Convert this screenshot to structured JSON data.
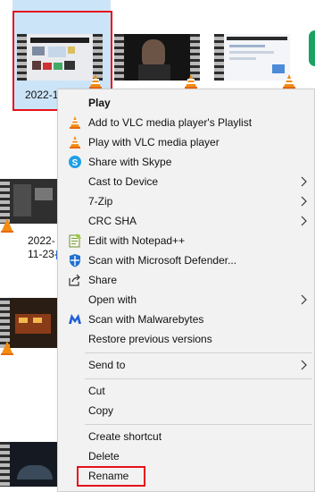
{
  "explorer": {
    "files": [
      {
        "name": "2022-1"
      },
      {
        "name": "2022-\n11-23-"
      }
    ],
    "icons": [
      "vlc-cone-icon"
    ]
  },
  "context_menu": {
    "items": [
      {
        "label": "Play",
        "icon": "none"
      },
      {
        "label": "Add to VLC media player's Playlist",
        "icon": "vlc-icon"
      },
      {
        "label": "Play with VLC media player",
        "icon": "vlc-icon"
      },
      {
        "label": "Share with Skype",
        "icon": "skype-icon"
      },
      {
        "label": "Cast to Device",
        "icon": "none"
      },
      {
        "label": "7-Zip",
        "icon": "none"
      },
      {
        "label": "CRC SHA",
        "icon": "none"
      },
      {
        "label": "Edit with Notepad++",
        "icon": "notepad-plus-plus-icon"
      },
      {
        "label": "Scan with Microsoft Defender...",
        "icon": "defender-icon"
      },
      {
        "label": "Share",
        "icon": "share-icon"
      },
      {
        "label": "Open with",
        "icon": "none"
      },
      {
        "label": "Scan with Malwarebytes",
        "icon": "malwarebytes-icon"
      },
      {
        "label": "Restore previous versions",
        "icon": "none"
      },
      {
        "label": "Send to",
        "icon": "none"
      },
      {
        "label": "Cut",
        "icon": "none"
      },
      {
        "label": "Copy",
        "icon": "none"
      },
      {
        "label": "Create shortcut",
        "icon": "none"
      },
      {
        "label": "Delete",
        "icon": "none"
      },
      {
        "label": "Rename",
        "icon": "none"
      }
    ]
  },
  "colors": {
    "highlight_red": "#e8101c",
    "selection_blue": "#cce4f7",
    "menu_bg": "#f2f2f2"
  }
}
